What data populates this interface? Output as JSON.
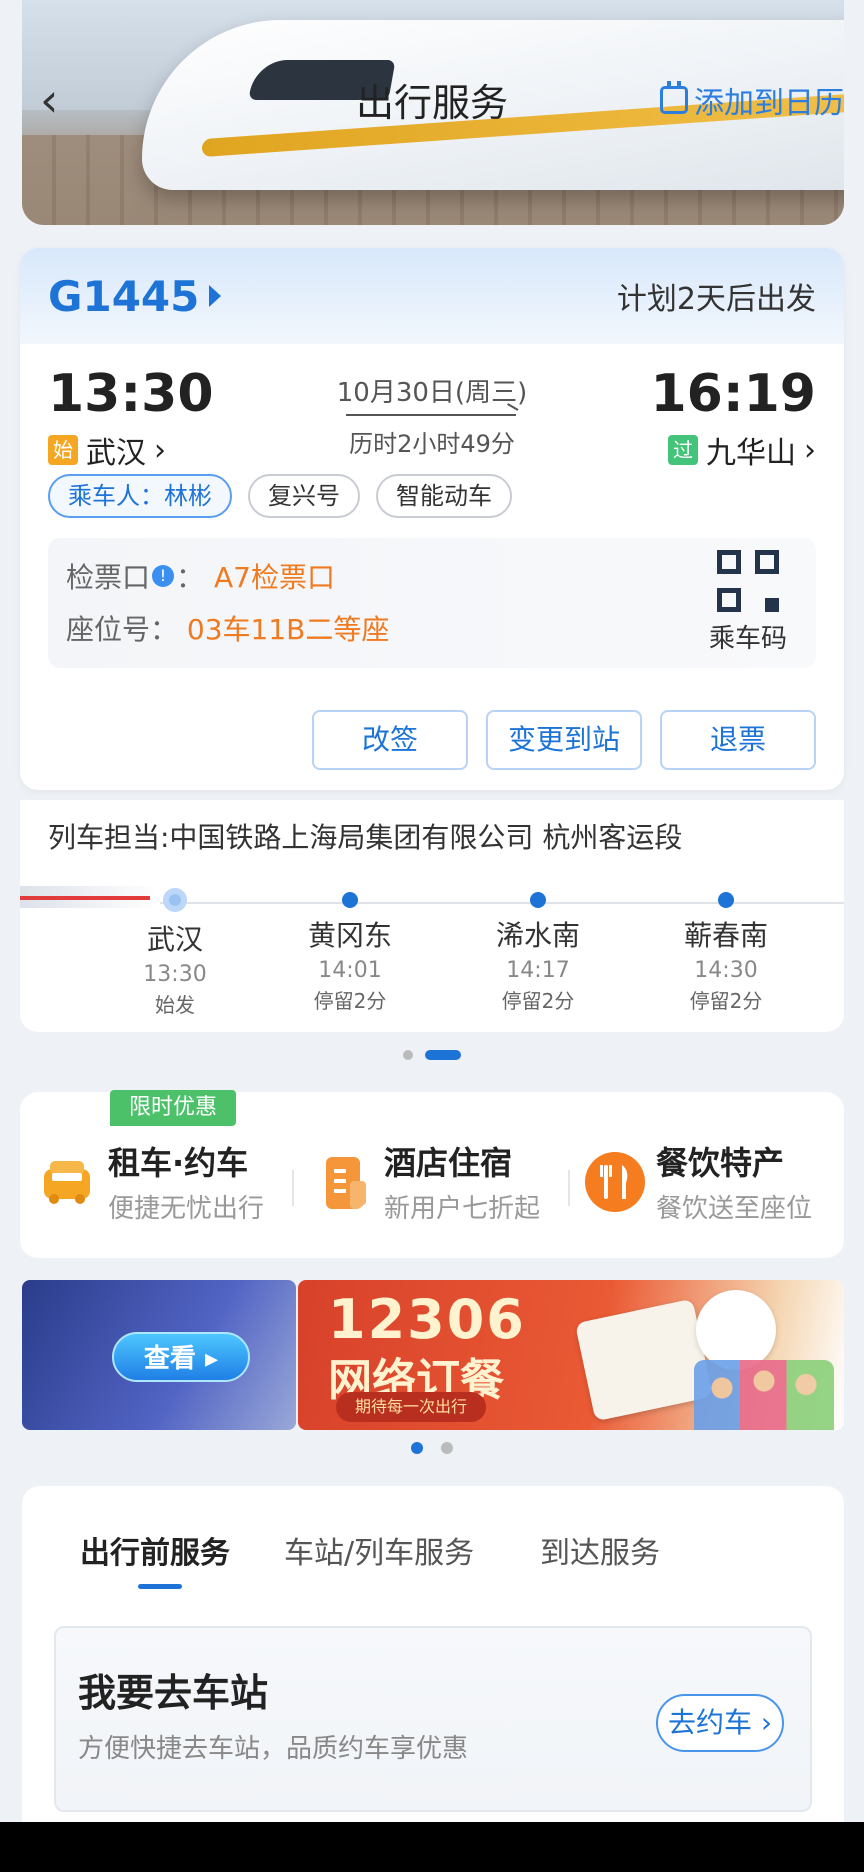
{
  "header": {
    "title": "出行服务",
    "back_icon": "‹",
    "add_calendar": "添加到日历"
  },
  "ticket": {
    "train_no": "G1445",
    "depart_plan": "计划2天后出发",
    "depart_time": "13:30",
    "arrive_time": "16:19",
    "date": "10月30日(周三)",
    "duration": "历时2小时49分",
    "from_tag": "始",
    "from_station": "武汉",
    "to_tag": "过",
    "to_station": "九华山",
    "chips": [
      "乘车人：林彬",
      "复兴号",
      "智能动车"
    ],
    "gate_label": "检票口",
    "gate_value": "A7检票口",
    "seat_label": "座位号：",
    "seat_value": "03车11B二等座",
    "qr_label": "乘车码",
    "actions": [
      "改签",
      "变更到站",
      "退票"
    ]
  },
  "route": {
    "operator": "列车担当:中国铁路上海局集团有限公司 杭州客运段",
    "stops": [
      {
        "name": "武汉",
        "time": "13:30",
        "note": "始发"
      },
      {
        "name": "黄冈东",
        "time": "14:01",
        "note": "停留2分"
      },
      {
        "name": "浠水南",
        "time": "14:17",
        "note": "停留2分"
      },
      {
        "name": "蕲春南",
        "time": "14:30",
        "note": "停留2分"
      }
    ]
  },
  "services": {
    "promo_badge": "限时优惠",
    "items": [
      {
        "title": "租车·约车",
        "desc": "便捷无忧出行",
        "icon": "taxi-icon"
      },
      {
        "title": "酒店住宿",
        "desc": "新用户七折起",
        "icon": "hotel-icon"
      },
      {
        "title": "餐饮特产",
        "desc": "餐饮送至座位",
        "icon": "dining-icon"
      }
    ]
  },
  "ads": {
    "left_button": "查看",
    "right_title": "12306",
    "right_subtitle": "网络订餐",
    "right_pill": "期待每一次出行"
  },
  "tabs": {
    "items": [
      "出行前服务",
      "车站/列车服务",
      "到达服务"
    ],
    "active": 0
  },
  "go_station": {
    "title": "我要去车站",
    "desc": "方便快捷去车站，品质约车享优惠",
    "button": "去约车"
  },
  "colors": {
    "accent": "#1e74d6",
    "highlight": "#f07a20",
    "promo": "#4cc16a"
  }
}
